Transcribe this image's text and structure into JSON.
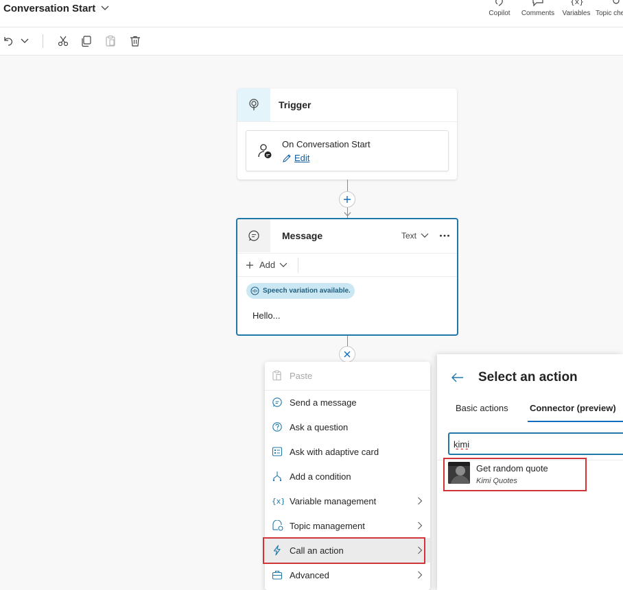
{
  "header": {
    "title": "Conversation Start",
    "tools": [
      {
        "label": "Copilot",
        "icon": "copilot-icon"
      },
      {
        "label": "Comments",
        "icon": "comment-icon"
      },
      {
        "label": "Variables",
        "icon": "variables-icon"
      },
      {
        "label": "Topic che",
        "icon": "topic-checker-icon"
      }
    ]
  },
  "toolbar": {
    "icons": [
      "undo-icon",
      "chevron-down-icon",
      "cut-icon",
      "copy-icon",
      "paste-icon",
      "delete-icon"
    ]
  },
  "trigger_node": {
    "title": "Trigger",
    "inner_title": "On Conversation Start",
    "edit_label": "Edit"
  },
  "message_node": {
    "title": "Message",
    "type_label": "Text",
    "add_label": "Add",
    "speech_badge": "Speech variation available.",
    "text": "Hello..."
  },
  "menu": {
    "items": [
      {
        "label": "Paste",
        "icon": "paste-icon",
        "disabled": true
      },
      {
        "label": "Send a message",
        "icon": "message-icon"
      },
      {
        "label": "Ask a question",
        "icon": "question-icon"
      },
      {
        "label": "Ask with adaptive card",
        "icon": "adaptive-card-icon"
      },
      {
        "label": "Add a condition",
        "icon": "condition-icon"
      },
      {
        "label": "Variable management",
        "icon": "variable-icon",
        "submenu": true
      },
      {
        "label": "Topic management",
        "icon": "topic-icon",
        "submenu": true
      },
      {
        "label": "Call an action",
        "icon": "action-icon",
        "submenu": true,
        "selected": true
      },
      {
        "label": "Advanced",
        "icon": "briefcase-icon",
        "submenu": true
      }
    ]
  },
  "action_panel": {
    "title": "Select an action",
    "tabs": [
      {
        "label": "Basic actions",
        "active": false
      },
      {
        "label": "Connector (preview)",
        "active": true
      }
    ],
    "search_value": "kimi",
    "results": [
      {
        "title": "Get random quote",
        "subtitle": "Kimi Quotes"
      }
    ]
  },
  "colors": {
    "accent": "#0f6cbd",
    "node_border": "#1f77a8",
    "highlight": "#d13438"
  }
}
